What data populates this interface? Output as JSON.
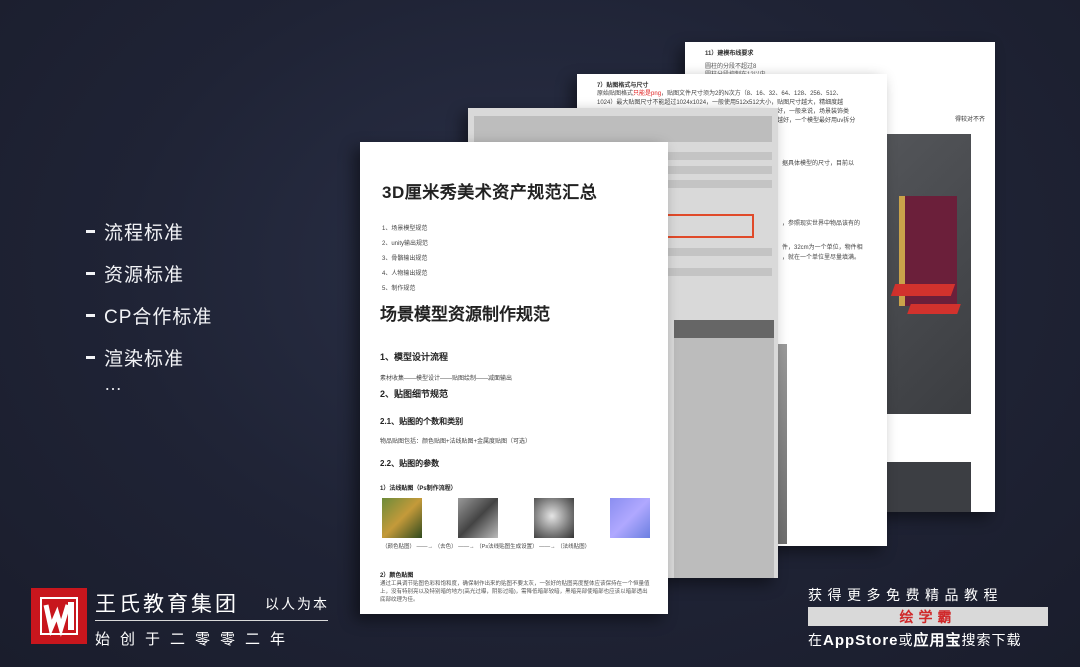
{
  "menu": {
    "items": [
      "流程标准",
      "资源标准",
      "CP合作标准",
      "渲染标准"
    ],
    "ellipsis": "…"
  },
  "pages": {
    "page4": {
      "heading": "11）建模布线要求",
      "line1": "圆柱的分段不超过8",
      "line2": "圆柱分段控制在12以内",
      "note": "得较对不齐"
    },
    "page3": {
      "heading": "7）贴图格式与尺寸",
      "text1": "原始贴图格式",
      "text1_red": "只能是png",
      "text1_rest": "，贴图文件尺寸须为2的N次方（8、16、32、64、128、256、512、",
      "text2": "1024）最大贴图尺寸不能超过1024x1024，一般使用512x512大小，贴图尺寸越大，精细度越",
      "text3": "好，一般来说，场景装饰类",
      "text4": "越好，一个模型最好用uv拆分",
      "text5": "据具体模型的尺寸，目前以",
      "text6": "，参照现实世界中物品该有的",
      "text7": "件，32cm为一个单位，物件相",
      "text8": "，就在一个单位里尽量填满。"
    },
    "page1": {
      "title": "3D厘米秀美术资产规范汇总",
      "toc": [
        "1、场景模型规范",
        "2、unity输出规范",
        "3、骨骼输出规范",
        "4、人物输出规范",
        "5、制作规范"
      ],
      "section_title": "场景模型资源制作规范",
      "s1": "1、模型设计流程",
      "s1_body": "素材收集——模型设计——贴图绘制——减面输出",
      "s2": "2、贴图细节规范",
      "s21": "2.1、贴图的个数和类别",
      "s21_body": "物品贴图包括：颜色贴图+法线贴图+金属度贴图（可选）",
      "s22": "2.2、贴图的参数",
      "s22_sub": "1）法线贴图（Ps制作流程）",
      "captions": [
        "（颜色贴图）",
        "（去色）",
        "（Ps法线贴图生成设置）",
        "（法线贴图）"
      ],
      "s2b": "2）颜色贴图",
      "para": "通过工具调节贴图色彩和饱和度，确保制作出来的贴图不要太灰，一张好的贴图亮度整体应该保持在一个恒量值上，没有特别亮以及特别暗的地方(高光过曝，阴影过暗)，需降低暗部较暗，黑暗亮部使暗部也应该以暗部透出底部纹理为佳。"
    }
  },
  "footer": {
    "brand": "王氏教育集团",
    "motto": "以人为本",
    "founded": "始创于二零零二年",
    "promo_line1": "获得更多免费精品教程",
    "promo_app": "绘学霸",
    "promo_line3_a": "在",
    "promo_line3_b": "AppStore",
    "promo_line3_c": "或",
    "promo_line3_d": "应用宝",
    "promo_line3_e": "搜索下载"
  },
  "colors": {
    "background": "#1f2335",
    "logo_red": "#c8161d",
    "promo_red": "#d0282a"
  }
}
